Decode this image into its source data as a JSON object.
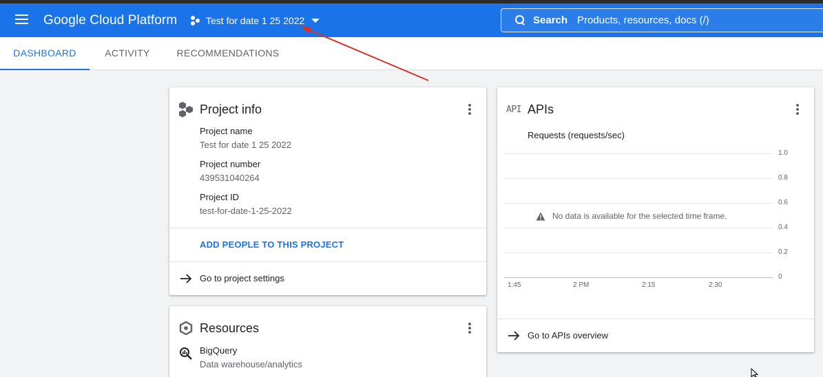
{
  "appbar": {
    "brand": "Google Cloud Platform",
    "project_label": "Test for date 1 25 2022",
    "search_label": "Search",
    "search_placeholder": "Products, resources, docs (/)"
  },
  "tabs": [
    {
      "label": "DASHBOARD",
      "active": true
    },
    {
      "label": "ACTIVITY",
      "active": false
    },
    {
      "label": "RECOMMENDATIONS",
      "active": false
    }
  ],
  "project_info": {
    "title": "Project info",
    "fields": [
      {
        "label": "Project name",
        "value": "Test for date 1 25 2022"
      },
      {
        "label": "Project number",
        "value": "439531040264"
      },
      {
        "label": "Project ID",
        "value": "test-for-date-1-25-2022"
      }
    ],
    "add_people": "ADD PEOPLE TO THIS PROJECT",
    "settings_link": "Go to project settings"
  },
  "resources": {
    "title": "Resources",
    "items": [
      {
        "name": "BigQuery",
        "description": "Data warehouse/analytics"
      }
    ]
  },
  "apis": {
    "icon_text": "API",
    "title": "APIs",
    "overview_link": "Go to APIs overview"
  },
  "chart_data": {
    "type": "line",
    "title": "Requests (requests/sec)",
    "x_ticks": [
      "1:45",
      "2 PM",
      "2:15",
      "2:30"
    ],
    "y_ticks": [
      "1.0",
      "0.8",
      "0.6",
      "0.4",
      "0.2",
      "0"
    ],
    "ylim": [
      0,
      1.0
    ],
    "series": [],
    "message": "No data is available for the selected time frame.",
    "grid": true
  },
  "annotation": {
    "color": "#d93025"
  },
  "colors": {
    "accent": "#1a73e8",
    "appbar": "#1a73e8"
  }
}
